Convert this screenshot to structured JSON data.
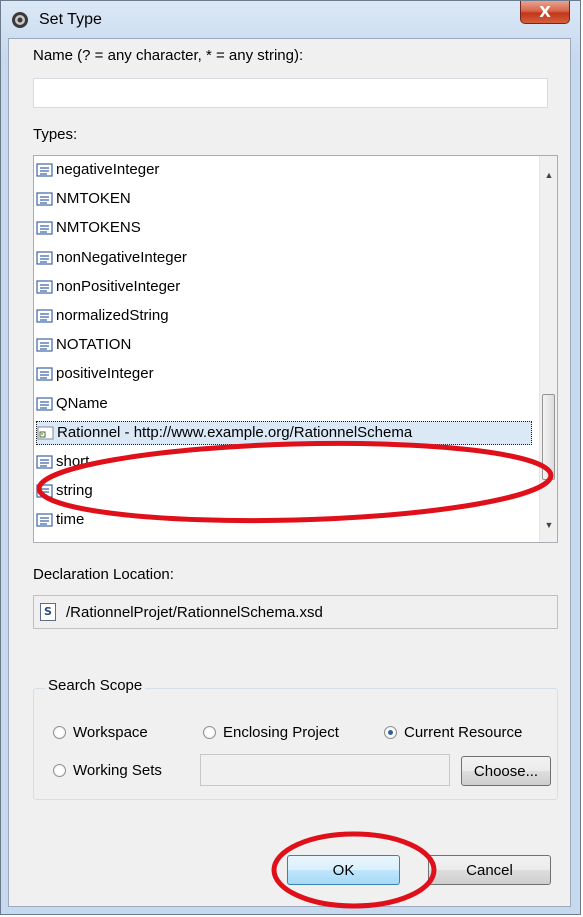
{
  "window": {
    "title": "Set Type",
    "close_glyph": "X"
  },
  "name_field": {
    "label": "Name (? = any character, * = any string):",
    "value": "",
    "placeholder": ""
  },
  "types": {
    "label": "Types:",
    "items": [
      {
        "label": "negativeInteger",
        "icon": "simple-type-icon"
      },
      {
        "label": "NMTOKEN",
        "icon": "simple-type-icon"
      },
      {
        "label": "NMTOKENS",
        "icon": "simple-type-icon"
      },
      {
        "label": "nonNegativeInteger",
        "icon": "simple-type-icon"
      },
      {
        "label": "nonPositiveInteger",
        "icon": "simple-type-icon"
      },
      {
        "label": "normalizedString",
        "icon": "simple-type-icon"
      },
      {
        "label": "NOTATION",
        "icon": "simple-type-icon"
      },
      {
        "label": "positiveInteger",
        "icon": "simple-type-icon"
      },
      {
        "label": "QName",
        "icon": "simple-type-icon"
      },
      {
        "label": "Rationnel - http://www.example.org/RationnelSchema",
        "icon": "complex-type-icon",
        "selected": true
      },
      {
        "label": "short",
        "icon": "simple-type-icon"
      },
      {
        "label": "string",
        "icon": "simple-type-icon"
      },
      {
        "label": "time",
        "icon": "simple-type-icon"
      }
    ]
  },
  "declaration": {
    "label": "Declaration Location:",
    "path": "/RationnelProjet/RationnelSchema.xsd",
    "icon_letter": "S"
  },
  "search_scope": {
    "legend": "Search Scope",
    "options": {
      "workspace": "Workspace",
      "enclosing_project": "Enclosing Project",
      "current_resource": "Current Resource",
      "working_sets": "Working Sets"
    },
    "selected": "current_resource",
    "choose_label": "Choose..."
  },
  "buttons": {
    "ok": "OK",
    "cancel": "Cancel"
  },
  "colors": {
    "annotation_red": "#e0101a",
    "selection": "#dbe9f7"
  }
}
